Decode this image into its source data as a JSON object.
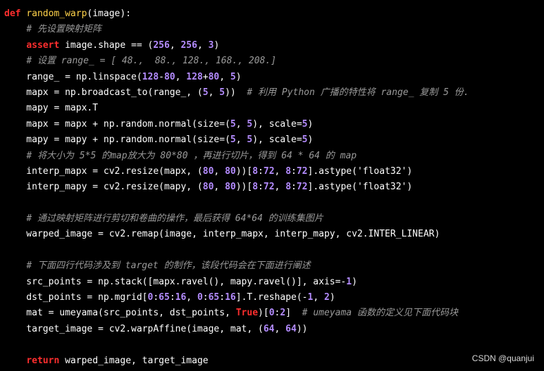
{
  "editor": {
    "background": "#000000",
    "colors": {
      "keyword": "#ff2e2e",
      "function_name": "#ffd24a",
      "number": "#b48cff",
      "comment": "#9a9a9a",
      "text": "#ffffff"
    },
    "lines": [
      [
        {
          "t": "def",
          "c": "keyword"
        },
        {
          "t": " "
        },
        {
          "t": "random_warp",
          "c": "funcname"
        },
        {
          "t": "(image):"
        }
      ],
      [
        {
          "t": "    "
        },
        {
          "t": "# 先设置映射矩阵",
          "c": "comment"
        }
      ],
      [
        {
          "t": "    "
        },
        {
          "t": "assert",
          "c": "keyword"
        },
        {
          "t": " image.shape == ("
        },
        {
          "t": "256",
          "c": "number"
        },
        {
          "t": ", "
        },
        {
          "t": "256",
          "c": "number"
        },
        {
          "t": ", "
        },
        {
          "t": "3",
          "c": "number"
        },
        {
          "t": ")"
        }
      ],
      [
        {
          "t": "    "
        },
        {
          "t": "# 设置 range_ = [ 48.,  88., 128., 168., 208.]",
          "c": "comment"
        }
      ],
      [
        {
          "t": "    range_ = np.linspace("
        },
        {
          "t": "128",
          "c": "number"
        },
        {
          "t": "-"
        },
        {
          "t": "80",
          "c": "number"
        },
        {
          "t": ", "
        },
        {
          "t": "128",
          "c": "number"
        },
        {
          "t": "+"
        },
        {
          "t": "80",
          "c": "number"
        },
        {
          "t": ", "
        },
        {
          "t": "5",
          "c": "number"
        },
        {
          "t": ")"
        }
      ],
      [
        {
          "t": "    mapx = np.broadcast_to(range_, ("
        },
        {
          "t": "5",
          "c": "number"
        },
        {
          "t": ", "
        },
        {
          "t": "5",
          "c": "number"
        },
        {
          "t": "))  "
        },
        {
          "t": "# 利用 Python 广播的特性将 range_ 复制 5 份.",
          "c": "comment"
        }
      ],
      [
        {
          "t": "    mapy = mapx.T"
        }
      ],
      [
        {
          "t": "    mapx = mapx "
        },
        {
          "t": "+",
          "c": "op"
        },
        {
          "t": " np.random.normal(size=("
        },
        {
          "t": "5",
          "c": "number"
        },
        {
          "t": ", "
        },
        {
          "t": "5",
          "c": "number"
        },
        {
          "t": "), scale="
        },
        {
          "t": "5",
          "c": "number"
        },
        {
          "t": ")"
        }
      ],
      [
        {
          "t": "    mapy = mapy "
        },
        {
          "t": "+",
          "c": "op"
        },
        {
          "t": " np.random.normal(size=("
        },
        {
          "t": "5",
          "c": "number"
        },
        {
          "t": ", "
        },
        {
          "t": "5",
          "c": "number"
        },
        {
          "t": "), scale="
        },
        {
          "t": "5",
          "c": "number"
        },
        {
          "t": ")"
        }
      ],
      [
        {
          "t": "    "
        },
        {
          "t": "# 将大小为 5*5 的map放大为 80*80 ，再进行切片，得到 64 * 64 的 map",
          "c": "comment"
        }
      ],
      [
        {
          "t": "    interp_mapx = cv2.resize(mapx, ("
        },
        {
          "t": "80",
          "c": "number"
        },
        {
          "t": ", "
        },
        {
          "t": "80",
          "c": "number"
        },
        {
          "t": "))["
        },
        {
          "t": "8",
          "c": "number"
        },
        {
          "t": ":"
        },
        {
          "t": "72",
          "c": "number"
        },
        {
          "t": ", "
        },
        {
          "t": "8",
          "c": "number"
        },
        {
          "t": ":"
        },
        {
          "t": "72",
          "c": "number"
        },
        {
          "t": "].astype('float32')"
        }
      ],
      [
        {
          "t": "    interp_mapy = cv2.resize(mapy, ("
        },
        {
          "t": "80",
          "c": "number"
        },
        {
          "t": ", "
        },
        {
          "t": "80",
          "c": "number"
        },
        {
          "t": "))["
        },
        {
          "t": "8",
          "c": "number"
        },
        {
          "t": ":"
        },
        {
          "t": "72",
          "c": "number"
        },
        {
          "t": ", "
        },
        {
          "t": "8",
          "c": "number"
        },
        {
          "t": ":"
        },
        {
          "t": "72",
          "c": "number"
        },
        {
          "t": "].astype('float32')"
        }
      ],
      [],
      [
        {
          "t": "    "
        },
        {
          "t": "# 通过映射矩阵进行剪切和卷曲的操作，最后获得 64*64 的训练集图片",
          "c": "comment"
        }
      ],
      [
        {
          "t": "    warped_image = cv2.remap(image, interp_mapx, interp_mapy, cv2.INTER_LINEAR)"
        }
      ],
      [],
      [
        {
          "t": "    "
        },
        {
          "t": "# 下面四行代码涉及到 target 的制作，该段代码会在下面进行阐述",
          "c": "comment"
        }
      ],
      [
        {
          "t": "    src_points = np.stack([mapx.ravel(), mapy.ravel()], axis=-"
        },
        {
          "t": "1",
          "c": "number"
        },
        {
          "t": ")"
        }
      ],
      [
        {
          "t": "    dst_points = np.mgrid["
        },
        {
          "t": "0",
          "c": "number"
        },
        {
          "t": ":"
        },
        {
          "t": "65",
          "c": "number"
        },
        {
          "t": ":"
        },
        {
          "t": "16",
          "c": "number"
        },
        {
          "t": ", "
        },
        {
          "t": "0",
          "c": "number"
        },
        {
          "t": ":"
        },
        {
          "t": "65",
          "c": "number"
        },
        {
          "t": ":"
        },
        {
          "t": "16",
          "c": "number"
        },
        {
          "t": "].T.reshape(-"
        },
        {
          "t": "1",
          "c": "number"
        },
        {
          "t": ", "
        },
        {
          "t": "2",
          "c": "number"
        },
        {
          "t": ")"
        }
      ],
      [
        {
          "t": "    mat = umeyama(src_points, dst_points, "
        },
        {
          "t": "True",
          "c": "keyword"
        },
        {
          "t": ")["
        },
        {
          "t": "0",
          "c": "number"
        },
        {
          "t": ":"
        },
        {
          "t": "2",
          "c": "number"
        },
        {
          "t": "]  "
        },
        {
          "t": "# umeyama 函数的定义见下面代码块",
          "c": "comment"
        }
      ],
      [
        {
          "t": "    target_image = cv2.warpAffine(image, mat, ("
        },
        {
          "t": "64",
          "c": "number"
        },
        {
          "t": ", "
        },
        {
          "t": "64",
          "c": "number"
        },
        {
          "t": "))"
        }
      ],
      [],
      [
        {
          "t": "    "
        },
        {
          "t": "return",
          "c": "keyword"
        },
        {
          "t": " warped_image, target_image"
        }
      ]
    ]
  },
  "watermark": {
    "text": "CSDN @quanjui"
  }
}
